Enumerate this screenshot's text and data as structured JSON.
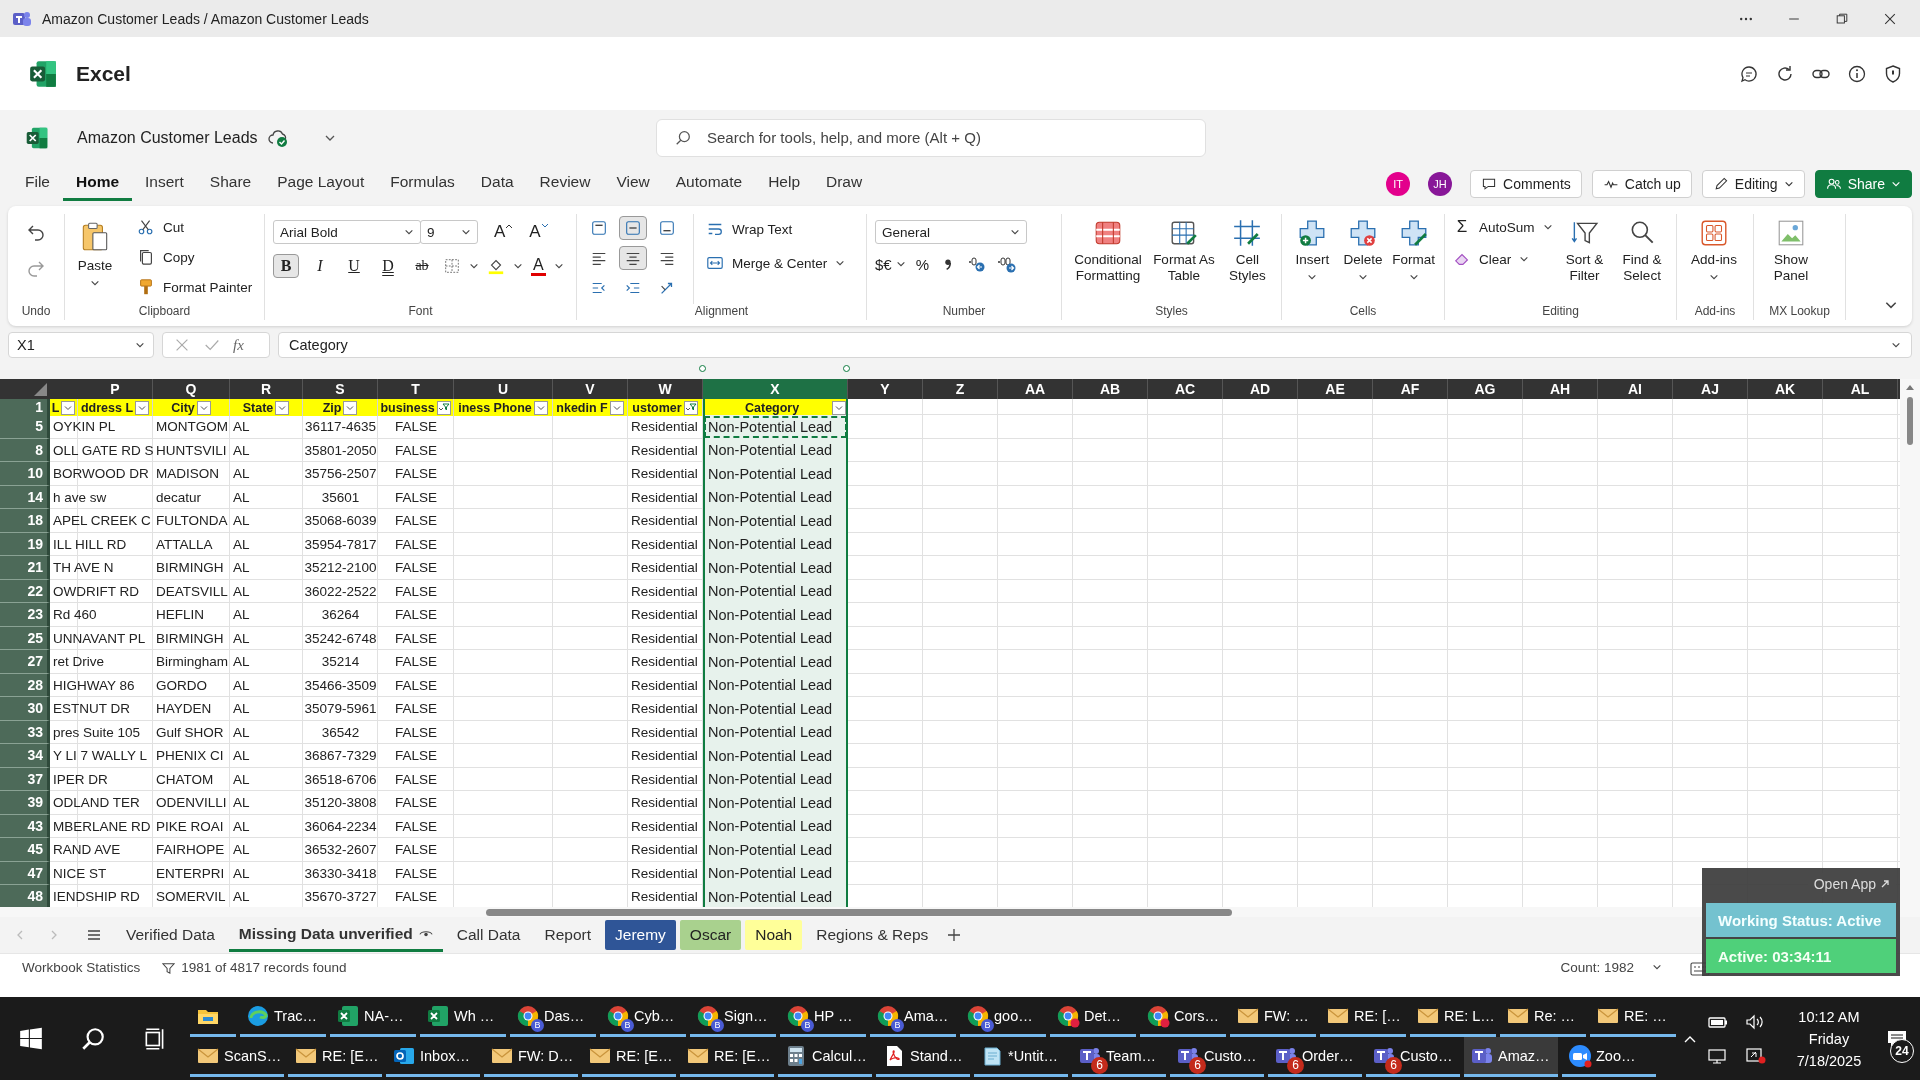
{
  "window": {
    "title": "Amazon Customer Leads / Amazon Customer Leads"
  },
  "app": {
    "name": "Excel"
  },
  "document": {
    "name": "Amazon Customer Leads"
  },
  "search": {
    "placeholder": "Search for tools, help, and more (Alt + Q)"
  },
  "menu_tabs": [
    {
      "label": "File",
      "selected": false
    },
    {
      "label": "Home",
      "selected": true
    },
    {
      "label": "Insert",
      "selected": false
    },
    {
      "label": "Share",
      "selected": false
    },
    {
      "label": "Page Layout",
      "selected": false
    },
    {
      "label": "Formulas",
      "selected": false
    },
    {
      "label": "Data",
      "selected": false
    },
    {
      "label": "Review",
      "selected": false
    },
    {
      "label": "View",
      "selected": false
    },
    {
      "label": "Automate",
      "selected": false
    },
    {
      "label": "Help",
      "selected": false
    },
    {
      "label": "Draw",
      "selected": false
    }
  ],
  "avatars": [
    {
      "initials": "IT",
      "color": "#e3008c"
    },
    {
      "initials": "JH",
      "color": "#881798"
    }
  ],
  "header_buttons": {
    "comments": "Comments",
    "catch_up": "Catch up",
    "editing": "Editing",
    "share": "Share"
  },
  "ribbon": {
    "undo": {
      "label": "Undo"
    },
    "clipboard": {
      "paste": "Paste",
      "cut": "Cut",
      "copy": "Copy",
      "format_painter": "Format Painter",
      "label": "Clipboard"
    },
    "font": {
      "family": "Arial Bold",
      "size": "9",
      "grow": "A",
      "shrink": "A",
      "color_glyph": "A",
      "label": "Font",
      "styles": [
        {
          "glyph": "B",
          "selected": true
        },
        {
          "glyph": "I",
          "selected": false
        },
        {
          "glyph": "U",
          "selected": false
        },
        {
          "glyph": "D",
          "selected": false
        },
        {
          "glyph": "ab",
          "selected": false
        }
      ]
    },
    "alignment": {
      "wrap": "Wrap Text",
      "merge": "Merge & Center",
      "label": "Alignment",
      "vertical": [
        {
          "selected": false
        },
        {
          "selected": true
        },
        {
          "selected": false
        }
      ],
      "horizontal": [
        {
          "selected": false
        },
        {
          "selected": true
        },
        {
          "selected": false
        }
      ]
    },
    "number": {
      "format": "General",
      "currency": "$€",
      "percent": "%",
      "label": "Number"
    },
    "styles": {
      "conditional": "Conditional Formatting",
      "format_table": "Format As Table",
      "cell_styles": "Cell Styles",
      "label": "Styles"
    },
    "cells": {
      "insert": "Insert",
      "delete": "Delete",
      "format": "Format",
      "label": "Cells"
    },
    "editing": {
      "sum_glyph": "Σ",
      "autosum": "AutoSum",
      "clear": "Clear",
      "sort": "Sort & Filter",
      "find": "Find & Select",
      "label": "Editing"
    },
    "addins": {
      "button": "Add-ins",
      "label": "Add-ins"
    },
    "mx": {
      "button": "Show Panel",
      "label": "MX Lookup"
    }
  },
  "formula_bar": {
    "name_box": "X1",
    "fx": "fx",
    "content": "Category"
  },
  "grid": {
    "columns": [
      {
        "letter": "P",
        "selected": false
      },
      {
        "letter": "Q",
        "selected": false
      },
      {
        "letter": "R",
        "selected": false
      },
      {
        "letter": "S",
        "selected": false
      },
      {
        "letter": "T",
        "selected": false
      },
      {
        "letter": "U",
        "selected": false
      },
      {
        "letter": "V",
        "selected": false
      },
      {
        "letter": "W",
        "selected": false
      },
      {
        "letter": "X",
        "selected": true
      },
      {
        "letter": "Y",
        "selected": false
      },
      {
        "letter": "Z",
        "selected": false
      },
      {
        "letter": "AA",
        "selected": false
      },
      {
        "letter": "AB",
        "selected": false
      },
      {
        "letter": "AC",
        "selected": false
      },
      {
        "letter": "AD",
        "selected": false
      },
      {
        "letter": "AE",
        "selected": false
      },
      {
        "letter": "AF",
        "selected": false
      },
      {
        "letter": "AG",
        "selected": false
      },
      {
        "letter": "AH",
        "selected": false
      },
      {
        "letter": "AI",
        "selected": false
      },
      {
        "letter": "AJ",
        "selected": false
      },
      {
        "letter": "AK",
        "selected": false
      },
      {
        "letter": "AL",
        "selected": false
      }
    ],
    "header_row": {
      "num": "1",
      "cells": [
        {
          "text": "L",
          "filtered": false
        },
        {
          "text": "ddress L",
          "filtered": false
        },
        {
          "text": "City",
          "filtered": false
        },
        {
          "text": "State",
          "filtered": false
        },
        {
          "text": "Zip",
          "filtered": false
        },
        {
          "text": "business",
          "filtered": true
        },
        {
          "text": "iness Phone",
          "filtered": false
        },
        {
          "text": "nkedin F",
          "filtered": false
        },
        {
          "text": "ustomer",
          "filtered": true
        },
        {
          "text": "Category",
          "filtered": false
        }
      ]
    },
    "rows": [
      {
        "num": "5",
        "address": "OYKIN PL",
        "city": "MONTGOM",
        "state": "AL",
        "zip": "36117-4635",
        "business": "FALSE",
        "customer": "Residential",
        "category": "Non-Potential Lead",
        "copied": true
      },
      {
        "num": "8",
        "address": "OLL GATE RD S",
        "city": "HUNTSVILI",
        "state": "AL",
        "zip": "35801-2050",
        "business": "FALSE",
        "customer": "Residential",
        "category": "Non-Potential Lead",
        "copied": false
      },
      {
        "num": "10",
        "address": "BORWOOD DR",
        "city": "MADISON",
        "state": "AL",
        "zip": "35756-2507",
        "business": "FALSE",
        "customer": "Residential",
        "category": "Non-Potential Lead",
        "copied": false
      },
      {
        "num": "14",
        "address": "h ave sw",
        "city": "decatur",
        "state": "AL",
        "zip": "35601",
        "business": "FALSE",
        "customer": "Residential",
        "category": "Non-Potential Lead",
        "copied": false
      },
      {
        "num": "18",
        "address": "APEL CREEK C",
        "city": "FULTONDA",
        "state": "AL",
        "zip": "35068-6039",
        "business": "FALSE",
        "customer": "Residential",
        "category": "Non-Potential Lead",
        "copied": false
      },
      {
        "num": "19",
        "address": "ILL HILL RD",
        "city": "ATTALLA",
        "state": "AL",
        "zip": "35954-7817",
        "business": "FALSE",
        "customer": "Residential",
        "category": "Non-Potential Lead",
        "copied": false
      },
      {
        "num": "21",
        "address": "TH AVE N",
        "city": "BIRMINGH",
        "state": "AL",
        "zip": "35212-2100",
        "business": "FALSE",
        "customer": "Residential",
        "category": "Non-Potential Lead",
        "copied": false
      },
      {
        "num": "22",
        "address": "OWDRIFT RD",
        "city": "DEATSVILL",
        "state": "AL",
        "zip": "36022-2522",
        "business": "FALSE",
        "customer": "Residential",
        "category": "Non-Potential Lead",
        "copied": false
      },
      {
        "num": "23",
        "address": "Rd 460",
        "city": "HEFLIN",
        "state": "AL",
        "zip": "36264",
        "business": "FALSE",
        "customer": "Residential",
        "category": "Non-Potential Lead",
        "copied": false
      },
      {
        "num": "25",
        "address": "UNNAVANT PL",
        "city": "BIRMINGH",
        "state": "AL",
        "zip": "35242-6748",
        "business": "FALSE",
        "customer": "Residential",
        "category": "Non-Potential Lead",
        "copied": false
      },
      {
        "num": "27",
        "address": "ret Drive",
        "city": "Birmingham",
        "state": "AL",
        "zip": "35214",
        "business": "FALSE",
        "customer": "Residential",
        "category": "Non-Potential Lead",
        "copied": false
      },
      {
        "num": "28",
        "address": "HIGHWAY 86",
        "city": "GORDO",
        "state": "AL",
        "zip": "35466-3509",
        "business": "FALSE",
        "customer": "Residential",
        "category": "Non-Potential Lead",
        "copied": false
      },
      {
        "num": "30",
        "address": "ESTNUT DR",
        "city": "HAYDEN",
        "state": "AL",
        "zip": "35079-5961",
        "business": "FALSE",
        "customer": "Residential",
        "category": "Non-Potential Lead",
        "copied": false
      },
      {
        "num": "33",
        "address": "pres Suite 105",
        "city": "Gulf SHOR",
        "state": "AL",
        "zip": "36542",
        "business": "FALSE",
        "customer": "Residential",
        "category": "Non-Potential Lead",
        "copied": false
      },
      {
        "num": "34",
        "address": "Y LI 7 WALLY L",
        "city": "PHENIX CI",
        "state": "AL",
        "zip": "36867-7329",
        "business": "FALSE",
        "customer": "Residential",
        "category": "Non-Potential Lead",
        "copied": false
      },
      {
        "num": "37",
        "address": "IPER DR",
        "city": "CHATOM",
        "state": "AL",
        "zip": "36518-6706",
        "business": "FALSE",
        "customer": "Residential",
        "category": "Non-Potential Lead",
        "copied": false
      },
      {
        "num": "39",
        "address": "ODLAND TER",
        "city": "ODENVILLI",
        "state": "AL",
        "zip": "35120-3808",
        "business": "FALSE",
        "customer": "Residential",
        "category": "Non-Potential Lead",
        "copied": false
      },
      {
        "num": "43",
        "address": "MBERLANE RD",
        "city": "PIKE ROAI",
        "state": "AL",
        "zip": "36064-2234",
        "business": "FALSE",
        "customer": "Residential",
        "category": "Non-Potential Lead",
        "copied": false
      },
      {
        "num": "45",
        "address": "RAND AVE",
        "city": "FAIRHOPE",
        "state": "AL",
        "zip": "36532-2607",
        "business": "FALSE",
        "customer": "Residential",
        "category": "Non-Potential Lead",
        "copied": false
      },
      {
        "num": "47",
        "address": "NICE ST",
        "city": "ENTERPRI",
        "state": "AL",
        "zip": "36330-3418",
        "business": "FALSE",
        "customer": "Residential",
        "category": "Non-Potential Lead",
        "copied": false
      },
      {
        "num": "48",
        "address": "IENDSHIP RD",
        "city": "SOMERVIL",
        "state": "AL",
        "zip": "35670-3727",
        "business": "FALSE",
        "customer": "Residential",
        "category": "Non-Potential Lead",
        "copied": false
      }
    ]
  },
  "sheet_tabs": [
    {
      "label": "Verified Data",
      "selected": false
    },
    {
      "label": "Missing Data unverified",
      "selected": true
    },
    {
      "label": "Call Data",
      "selected": false
    },
    {
      "label": "Report",
      "selected": false
    },
    {
      "label": "Jeremy",
      "selected": false,
      "color": "#2f5597"
    },
    {
      "label": "Oscar",
      "selected": false,
      "color": "#a9d18e"
    },
    {
      "label": "Noah",
      "selected": false,
      "color": "#ffff99"
    },
    {
      "label": "Regions & Reps",
      "selected": false
    }
  ],
  "status_bar": {
    "statistics": "Workbook Statistics",
    "filter": "1981 of 4817 records found",
    "count": "Count: 1982"
  },
  "overlay": {
    "open_app": "Open App",
    "status": "Working Status: Active",
    "timer": "Active: 03:34:11"
  },
  "taskbar": {
    "row1": [
      {
        "kind": "folder",
        "selected": false
      },
      {
        "kind": "edge",
        "label": "Trac…",
        "selected": false
      },
      {
        "kind": "excel",
        "label": "NA-…",
        "selected": false
      },
      {
        "kind": "excel",
        "label": "Wh …",
        "selected": false
      },
      {
        "kind": "chrome",
        "label": "Das…",
        "profile": "B",
        "selected": false
      },
      {
        "kind": "chrome",
        "label": "Cyb…",
        "profile": "B",
        "selected": false
      },
      {
        "kind": "chrome",
        "label": "Sign…",
        "profile": "B",
        "selected": false
      },
      {
        "kind": "chrome",
        "label": "HP …",
        "profile": "B",
        "selected": false
      },
      {
        "kind": "chrome",
        "label": "Ama…",
        "profile": "B",
        "selected": false
      },
      {
        "kind": "chrome",
        "label": "goo…",
        "profile": "B",
        "selected": false
      },
      {
        "kind": "chrome",
        "label": "Det…",
        "selected": false
      },
      {
        "kind": "chrome",
        "label": "Cors…",
        "selected": false
      },
      {
        "kind": "mail",
        "label": "FW: …",
        "selected": false
      },
      {
        "kind": "mail",
        "label": "RE: […",
        "selected": false
      },
      {
        "kind": "mail",
        "label": "RE: L…",
        "selected": false
      },
      {
        "kind": "mail",
        "label": "Re: …",
        "selected": false
      },
      {
        "kind": "mail",
        "label": "RE: …",
        "selected": false
      }
    ],
    "row2": [
      {
        "kind": "mail",
        "label": "ScanS…",
        "selected": false
      },
      {
        "kind": "mail",
        "label": "RE: [E…",
        "selected": false
      },
      {
        "kind": "outlook",
        "label": "Inbox…",
        "selected": false
      },
      {
        "kind": "mail",
        "label": "FW: D…",
        "selected": false
      },
      {
        "kind": "mail",
        "label": "RE: [E…",
        "selected": false
      },
      {
        "kind": "mail",
        "label": "RE: [E…",
        "selected": false
      },
      {
        "kind": "calculator",
        "label": "Calcul…",
        "selected": false
      },
      {
        "kind": "pdf",
        "label": "Stand…",
        "selected": false
      },
      {
        "kind": "notepad",
        "label": "*Untit…",
        "selected": false
      },
      {
        "kind": "teams",
        "label": "Team…",
        "badge": "6",
        "selected": false
      },
      {
        "kind": "teams",
        "label": "Custo…",
        "badge": "6",
        "selected": false
      },
      {
        "kind": "teams",
        "label": "Order…",
        "badge": "6",
        "selected": false
      },
      {
        "kind": "teams",
        "label": "Custo…",
        "badge": "6",
        "selected": false
      },
      {
        "kind": "teams",
        "label": "Amaz…",
        "selected": true
      },
      {
        "kind": "zoom",
        "label": "Zoo…",
        "selected": false
      }
    ],
    "time": "10:12 AM",
    "day": "Friday",
    "date": "7/18/2025",
    "notifications": "24"
  }
}
